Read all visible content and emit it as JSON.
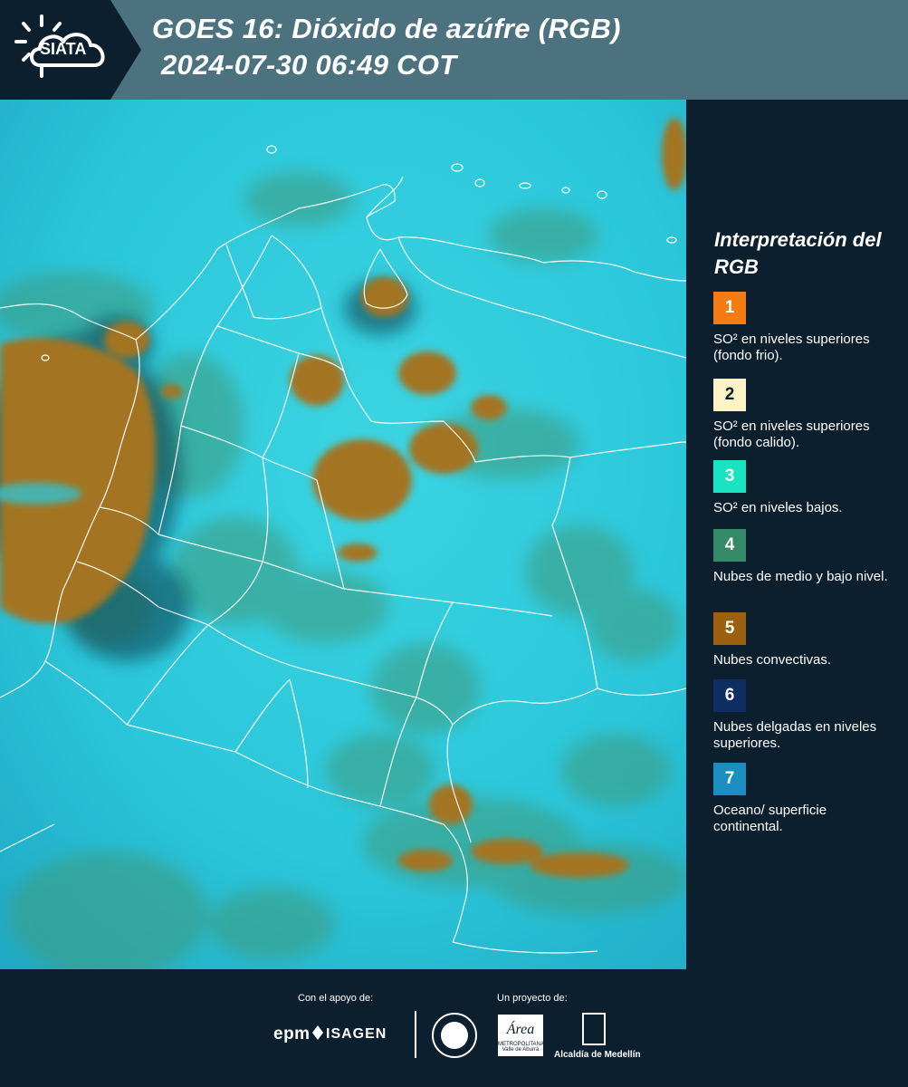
{
  "header": {
    "logo_text": "SIATA",
    "title_line1": "GOES 16: Dióxido de azúfre (RGB)",
    "title_line2": "2024-07-30 06:49 COT"
  },
  "legend": {
    "title": "Interpretación del RGB",
    "items": [
      {
        "number": "1",
        "color": "#f47c13",
        "label": "SO² en niveles superiores (fondo frio)."
      },
      {
        "number": "2",
        "color": "#fdf3c4",
        "label": "SO² en niveles superiores (fondo calido)."
      },
      {
        "number": "3",
        "color": "#19e3c1",
        "label": "SO² en niveles bajos."
      },
      {
        "number": "4",
        "color": "#348a66",
        "label": "Nubes de medio y bajo nivel."
      },
      {
        "number": "5",
        "color": "#9a6010",
        "label": "Nubes convectivas."
      },
      {
        "number": "6",
        "color": "#0f2f63",
        "label": "Nubes delgadas en niveles superiores."
      },
      {
        "number": "7",
        "color": "#1b8fc0",
        "label": "Oceano/ superficie continental."
      }
    ]
  },
  "footer": {
    "support_label": "Con el apoyo de:",
    "project_label": "Un proyecto de:",
    "sponsor_epm": "epm",
    "sponsor_isagen": "ISAGEN",
    "area_logo": "Área",
    "area_sub": "METROPOLITANA Valle de Aburrá",
    "alcaldia": "Alcaldía de Medellín"
  },
  "map_colors": {
    "base": "#29c9dc",
    "convective": "#a37421",
    "midlevel": "#3f9a7a",
    "border": "#ffffff"
  }
}
